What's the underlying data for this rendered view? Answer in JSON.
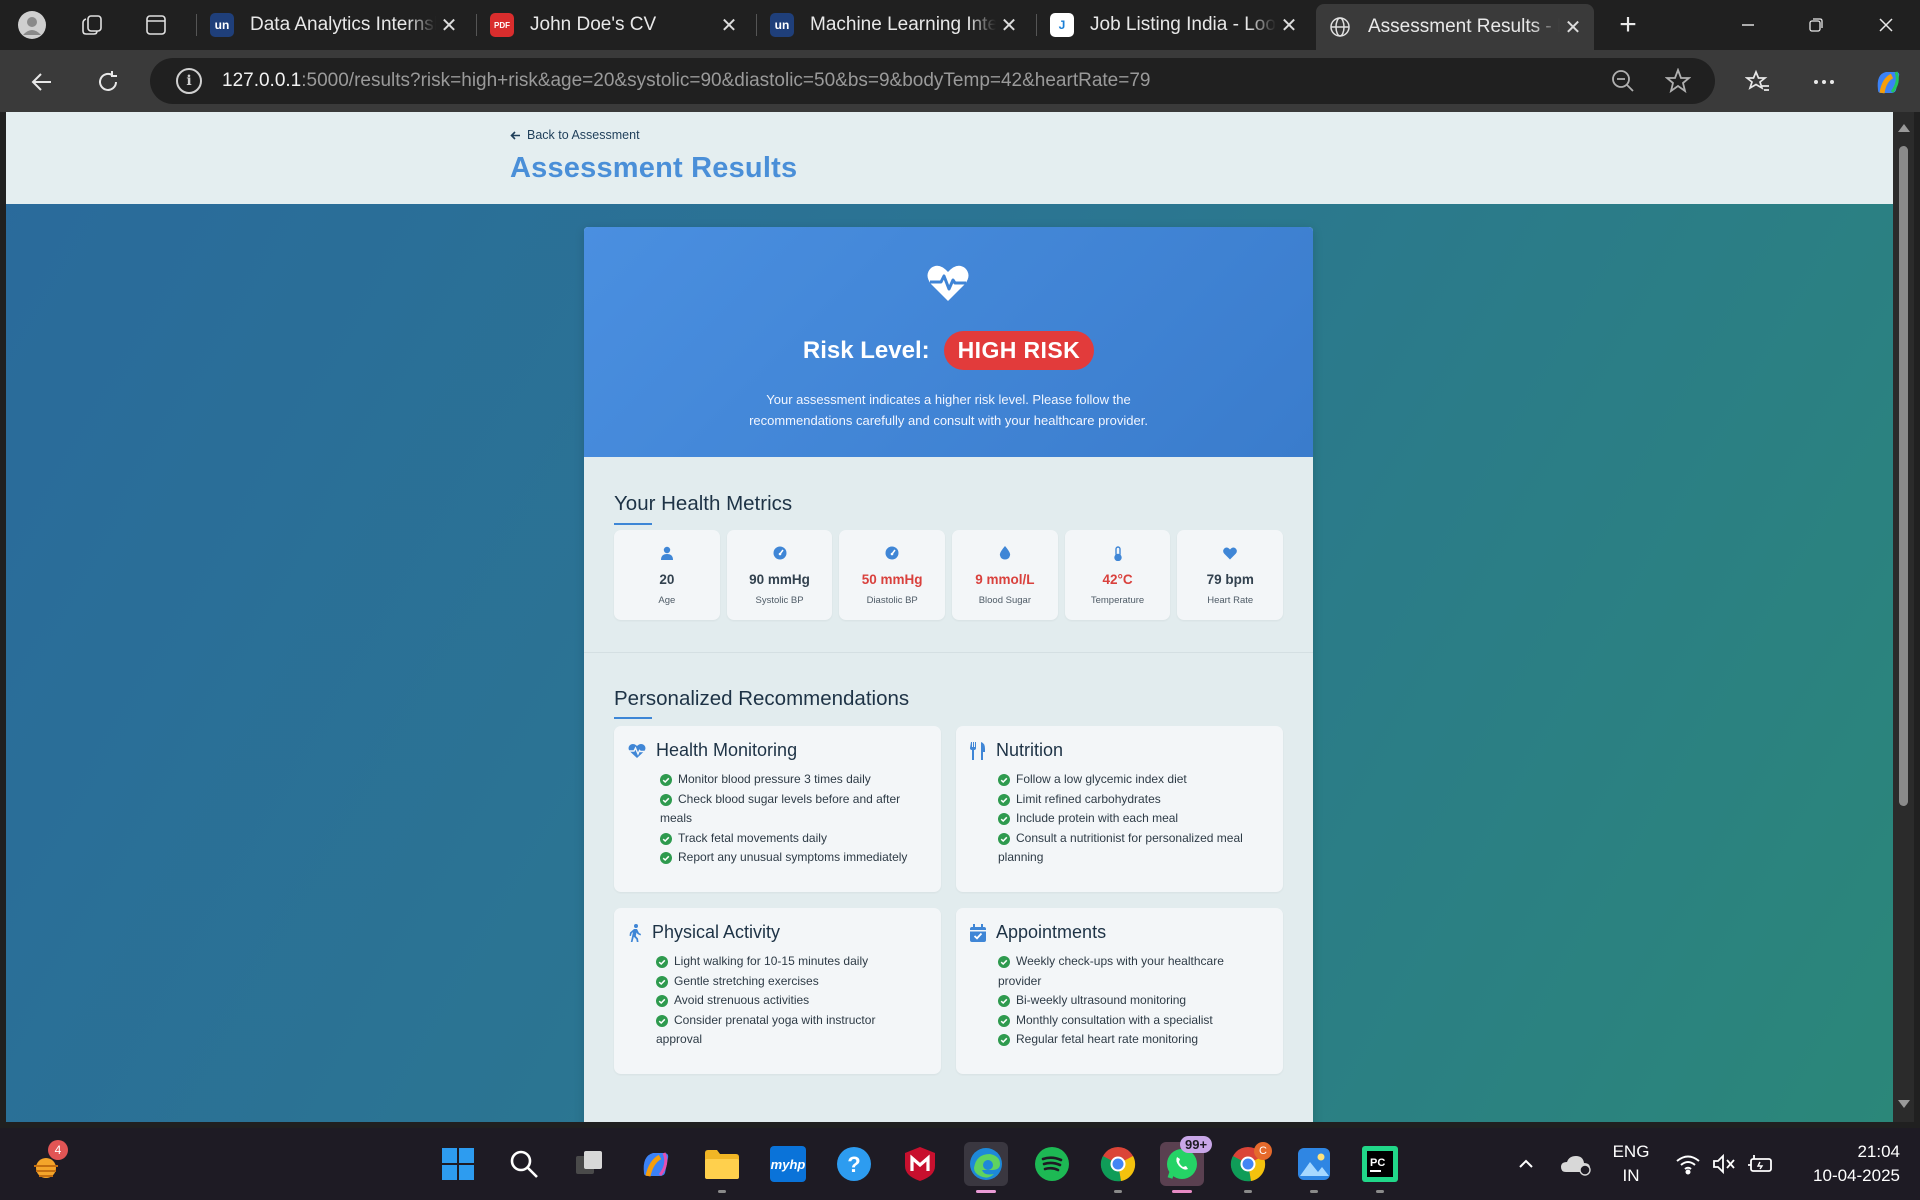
{
  "browser": {
    "tabs": [
      {
        "title": "Data Analytics Internship",
        "favicon_text": "un",
        "favicon_color": "#1f3f7a"
      },
      {
        "title": "John Doe's CV",
        "favicon_text": "PDF",
        "favicon_color": "#d92d2d"
      },
      {
        "title": "Machine Learning Internship",
        "favicon_text": "un",
        "favicon_color": "#1f3f7a"
      },
      {
        "title": "Job Listing India - Looking",
        "favicon_text": "J",
        "favicon_color": "#ffffff"
      },
      {
        "title": "Assessment Results - Pregnancy",
        "favicon_text": "",
        "favicon_color": "#3a3a3a"
      }
    ],
    "close_glyph": "✕",
    "new_tab_glyph": "+",
    "url_host": "127.0.0.1",
    "url_rest": ":5000/results?risk=high+risk&age=20&systolic=90&diastolic=50&bs=9&bodyTemp=42&heartRate=79"
  },
  "page": {
    "back_link": "Back to Assessment",
    "title": "Assessment Results",
    "risk_label": "Risk Level:",
    "risk_value": "HIGH RISK",
    "risk_message": "Your assessment indicates a higher risk level. Please follow the recommendations carefully and consult with your healthcare provider.",
    "metrics_title": "Your Health Metrics",
    "metrics": [
      {
        "value": "20",
        "label": "Age",
        "icon": "user-icon",
        "alert": false
      },
      {
        "value": "90 mmHg",
        "label": "Systolic BP",
        "icon": "gauge-icon",
        "alert": false
      },
      {
        "value": "50 mmHg",
        "label": "Diastolic BP",
        "icon": "gauge-icon",
        "alert": true
      },
      {
        "value": "9 mmol/L",
        "label": "Blood Sugar",
        "icon": "droplet-icon",
        "alert": true
      },
      {
        "value": "42°C",
        "label": "Temperature",
        "icon": "thermometer-icon",
        "alert": true
      },
      {
        "value": "79 bpm",
        "label": "Heart Rate",
        "icon": "heart-icon",
        "alert": false
      }
    ],
    "recommendations_title": "Personalized Recommendations",
    "recommendations": [
      {
        "title": "Health Monitoring",
        "icon": "heartbeat-icon",
        "items": [
          "Monitor blood pressure 3 times daily",
          "Check blood sugar levels before and after meals",
          "Track fetal movements daily",
          "Report any unusual symptoms immediately"
        ]
      },
      {
        "title": "Nutrition",
        "icon": "utensils-icon",
        "items": [
          "Follow a low glycemic index diet",
          "Limit refined carbohydrates",
          "Include protein with each meal",
          "Consult a nutritionist for personalized meal planning"
        ]
      },
      {
        "title": "Physical Activity",
        "icon": "walking-icon",
        "items": [
          "Light walking for 10-15 minutes daily",
          "Gentle stretching exercises",
          "Avoid strenuous activities",
          "Consider prenatal yoga with instructor approval"
        ]
      },
      {
        "title": "Appointments",
        "icon": "calendar-check-icon",
        "items": [
          "Weekly check-ups with your healthcare provider",
          "Bi-weekly ultrasound monitoring",
          "Monthly consultation with a specialist",
          "Regular fetal heart rate monitoring"
        ]
      }
    ]
  },
  "taskbar": {
    "widgets_badge": "4",
    "whatsapp_badge": "99+",
    "chrome_badge": "C",
    "language": "ENG",
    "region": "IN",
    "time": "21:04",
    "date": "10-04-2025"
  },
  "colors": {
    "accent": "#4a8fd8",
    "alert": "#d9413d",
    "risk_pill": "#e23b3b",
    "check": "#2e9a4e"
  }
}
